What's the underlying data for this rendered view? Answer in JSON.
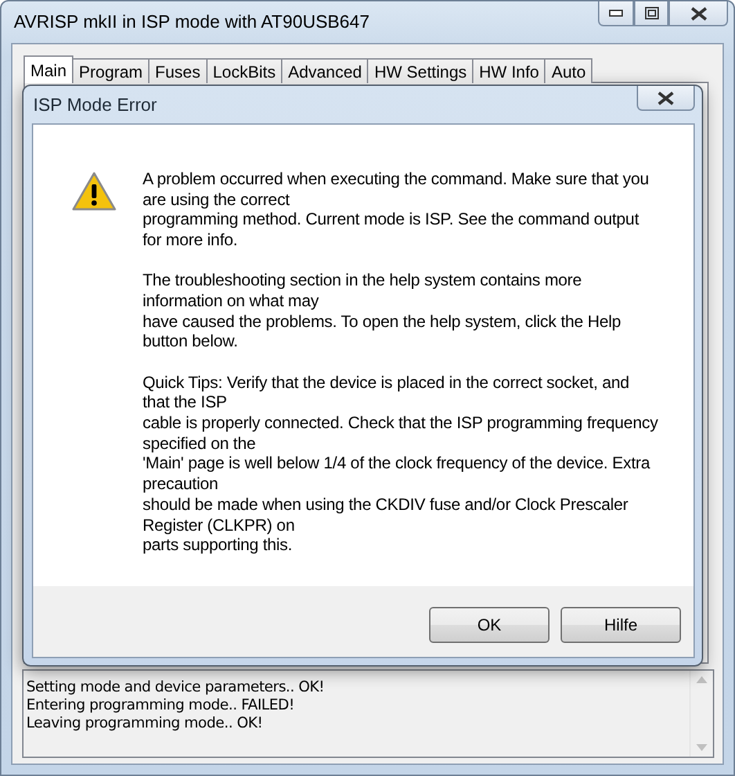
{
  "window": {
    "title": "AVRISP mkII in ISP mode with AT90USB647"
  },
  "tabs": [
    {
      "label": "Main",
      "selected": true
    },
    {
      "label": "Program",
      "selected": false
    },
    {
      "label": "Fuses",
      "selected": false
    },
    {
      "label": "LockBits",
      "selected": false
    },
    {
      "label": "Advanced",
      "selected": false
    },
    {
      "label": "HW Settings",
      "selected": false
    },
    {
      "label": "HW Info",
      "selected": false
    },
    {
      "label": "Auto",
      "selected": false
    }
  ],
  "dialog": {
    "title": "ISP Mode Error",
    "paragraphs": [
      [
        "A problem occurred when executing the command. Make sure that you",
        "are using the correct",
        "programming method. Current mode is ISP. See the command output",
        "for more info."
      ],
      [
        "The troubleshooting section in the help system contains more",
        "information on what may",
        "have caused the problems. To open the help system, click the Help",
        "button below."
      ],
      [
        "Quick Tips: Verify that the device is placed in the correct socket, and",
        "that the ISP",
        "cable is properly connected. Check that the ISP programming frequency",
        "specified on the",
        "'Main' page is well below 1/4 of the clock frequency of the device. Extra",
        "precaution",
        "should be made when using the CKDIV fuse and/or Clock Prescaler",
        "Register (CLKPR) on",
        "parts supporting this."
      ]
    ],
    "buttons": [
      "OK",
      "Hilfe"
    ]
  },
  "log": [
    "Setting mode and device parameters.. OK!",
    "Entering programming mode.. FAILED!",
    "Leaving programming mode.. OK!"
  ]
}
